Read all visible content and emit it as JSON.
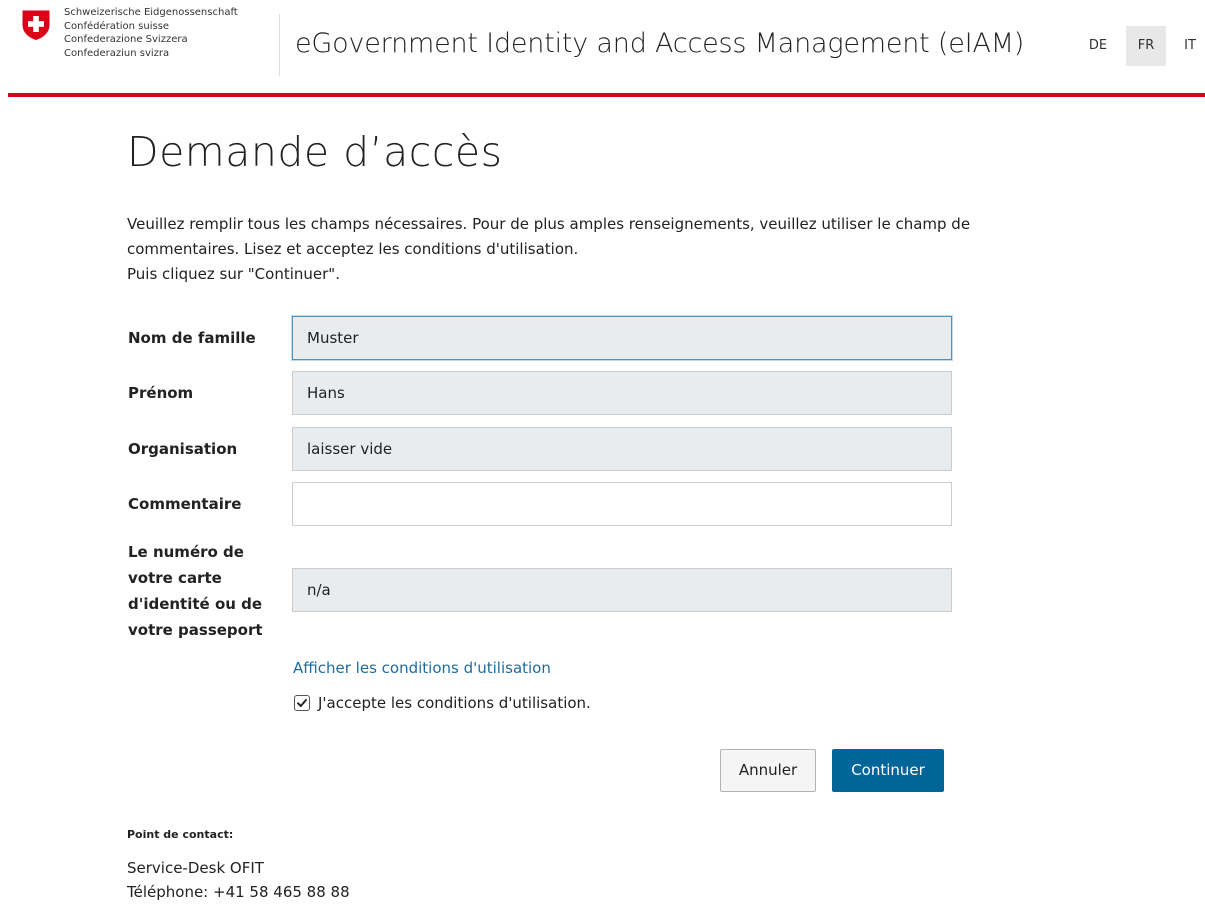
{
  "header": {
    "confederation_lines": [
      "Schweizerische Eidgenossenschaft",
      "Confédération suisse",
      "Confederazione Svizzera",
      "Confederaziun svizra"
    ],
    "app_title": "eGovernment Identity and Access Management (eIAM)",
    "languages": [
      {
        "code": "DE",
        "active": false
      },
      {
        "code": "FR",
        "active": true
      },
      {
        "code": "IT",
        "active": false
      }
    ]
  },
  "page": {
    "title": "Demande d’accès",
    "intro_lines": [
      "Veuillez remplir tous les champs nécessaires. Pour de plus amples renseignements, veuillez utiliser le champ de",
      "commentaires. Lisez et acceptez les conditions d'utilisation.",
      "Puis cliquez sur \"Continuer\"."
    ]
  },
  "form": {
    "last_name": {
      "label": "Nom de famille",
      "value": "Muster"
    },
    "first_name": {
      "label": "Prénom",
      "value": "Hans"
    },
    "organisation": {
      "label": "Organisation",
      "value": "laisser vide"
    },
    "comment": {
      "label": "Commentaire",
      "value": ""
    },
    "id_number": {
      "label_lines": [
        "Le numéro de",
        "votre carte",
        "d'identité ou de",
        "votre passeport"
      ],
      "value": "n/a"
    },
    "terms_link": "Afficher les conditions d'utilisation",
    "accept_terms": {
      "label": "J'accepte les conditions d'utilisation.",
      "checked": true
    },
    "cancel_label": "Annuler",
    "continue_label": "Continuer"
  },
  "contact": {
    "heading": "Point de contact:",
    "service": "Service-Desk OFIT",
    "phone": "Téléphone: +41 58 465 88 88"
  },
  "colors": {
    "accent_red": "#dc0018",
    "primary_button": "#006699",
    "link": "#1f6c9c"
  }
}
